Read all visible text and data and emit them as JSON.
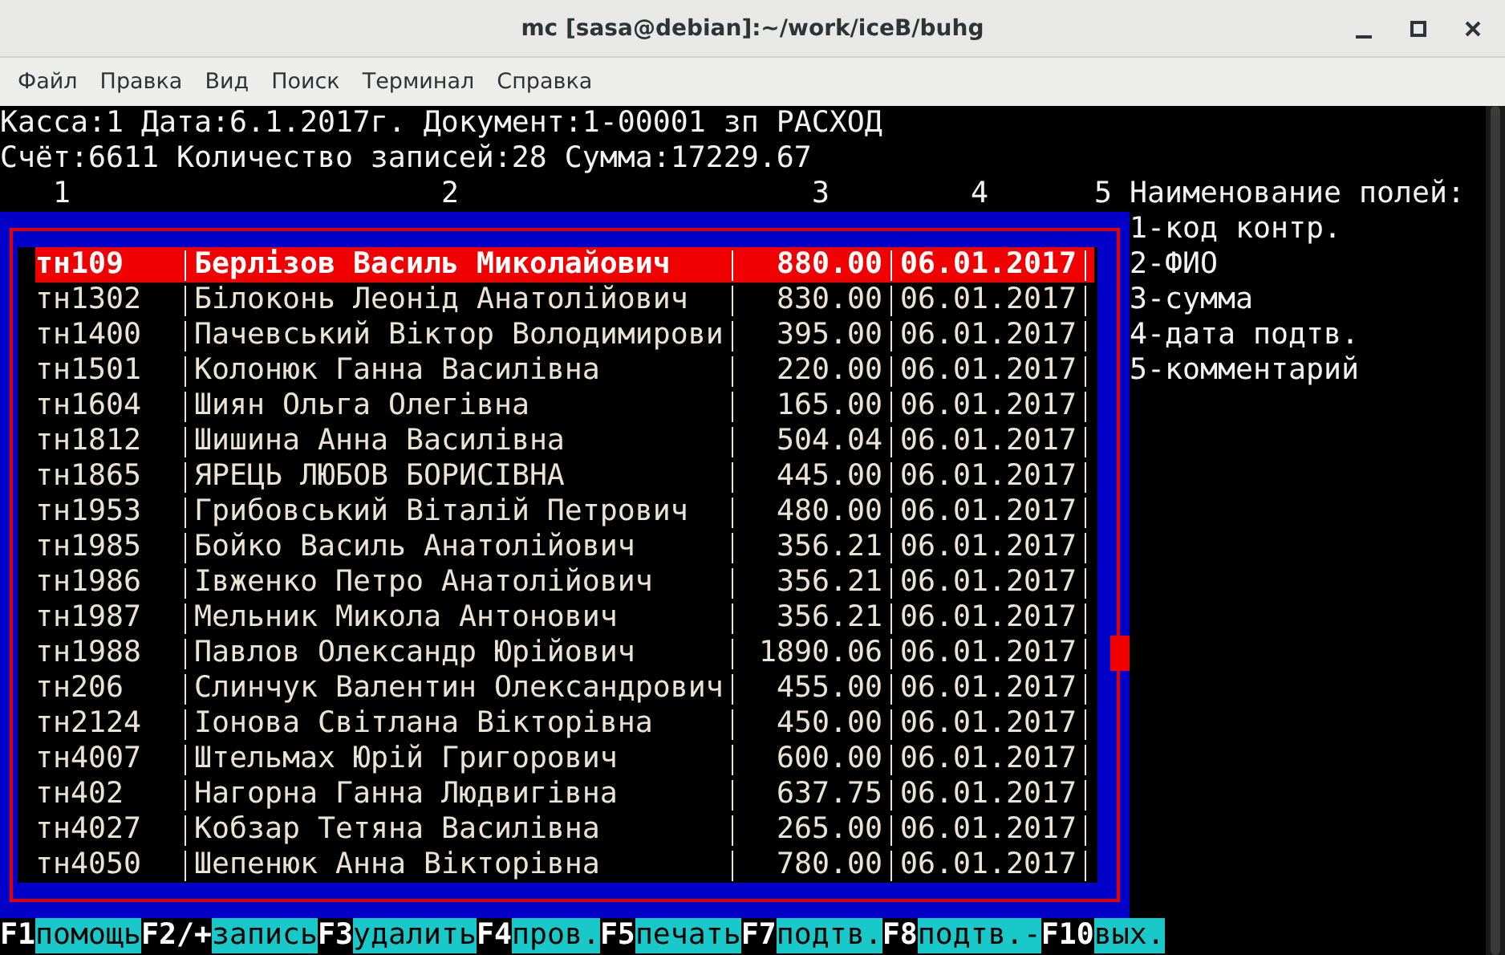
{
  "window": {
    "title": "mc [sasa@debian]:~/work/iceB/buhg"
  },
  "menu": [
    "Файл",
    "Правка",
    "Вид",
    "Поиск",
    "Терминал",
    "Справка"
  ],
  "header_lines": [
    "Касса:1 Дата:6.1.2017г. Документ:1-00001 зп РАСХОД",
    "Счёт:6611 Количество записей:28 Сумма:17229.67"
  ],
  "table": {
    "columns": [
      "1",
      "2",
      "3",
      "4",
      "5"
    ],
    "rows": [
      {
        "code": "тн109",
        "name": "Берлізов Василь Миколайович",
        "amount": "880.00",
        "date": "06.01.2017",
        "selected": true
      },
      {
        "code": "тн1302",
        "name": "Білоконь Леонід Анатолійович",
        "amount": "830.00",
        "date": "06.01.2017",
        "selected": false
      },
      {
        "code": "тн1400",
        "name": "Пачевський Віктор Володимирови",
        "amount": "395.00",
        "date": "06.01.2017",
        "selected": false
      },
      {
        "code": "тн1501",
        "name": "Колонюк Ганна Василівна",
        "amount": "220.00",
        "date": "06.01.2017",
        "selected": false
      },
      {
        "code": "тн1604",
        "name": "Шиян Ольга Олегівна",
        "amount": "165.00",
        "date": "06.01.2017",
        "selected": false
      },
      {
        "code": "тн1812",
        "name": "Шишина Анна Василівна",
        "amount": "504.04",
        "date": "06.01.2017",
        "selected": false
      },
      {
        "code": "тн1865",
        "name": "ЯРЕЦЬ ЛЮБОВ БОРИСІВНА",
        "amount": "445.00",
        "date": "06.01.2017",
        "selected": false
      },
      {
        "code": "тн1953",
        "name": "Грибовський Віталій Петрович",
        "amount": "480.00",
        "date": "06.01.2017",
        "selected": false
      },
      {
        "code": "тн1985",
        "name": "Бойко Василь Анатолійович",
        "amount": "356.21",
        "date": "06.01.2017",
        "selected": false
      },
      {
        "code": "тн1986",
        "name": "Івженко Петро Анатолійович",
        "amount": "356.21",
        "date": "06.01.2017",
        "selected": false
      },
      {
        "code": "тн1987",
        "name": "Мельник Микола Антонович",
        "amount": "356.21",
        "date": "06.01.2017",
        "selected": false
      },
      {
        "code": "тн1988",
        "name": "Павлов Олександр Юрійович",
        "amount": "1890.06",
        "date": "06.01.2017",
        "selected": false
      },
      {
        "code": "тн206",
        "name": "Слинчук Валентин Олександрович",
        "amount": "455.00",
        "date": "06.01.2017",
        "selected": false
      },
      {
        "code": "тн2124",
        "name": "Іонова Світлана Вікторівна",
        "amount": "450.00",
        "date": "06.01.2017",
        "selected": false
      },
      {
        "code": "тн4007",
        "name": "Штельмах Юрій Григорович",
        "amount": "600.00",
        "date": "06.01.2017",
        "selected": false
      },
      {
        "code": "тн402",
        "name": "Нагорна Ганна Людвигівна",
        "amount": "637.75",
        "date": "06.01.2017",
        "selected": false
      },
      {
        "code": "тн4027",
        "name": "Кобзар Тетяна Василівна",
        "amount": "265.00",
        "date": "06.01.2017",
        "selected": false
      },
      {
        "code": "тн4050",
        "name": "Шепенюк Анна Вікторівна",
        "amount": "780.00",
        "date": "06.01.2017",
        "selected": false
      }
    ]
  },
  "legend": {
    "title": "Наименование полей:",
    "items": [
      "1-код контр.",
      "2-ФИО",
      "3-сумма",
      "4-дата подтв.",
      "5-комментарий"
    ]
  },
  "function_keys": [
    {
      "key": "F1",
      "label": "помощь"
    },
    {
      "key": "F2/+",
      "label": "запись"
    },
    {
      "key": "F3",
      "label": "удалить"
    },
    {
      "key": "F4",
      "label": "пров."
    },
    {
      "key": "F5",
      "label": "печать"
    },
    {
      "key": "F7",
      "label": "подтв."
    },
    {
      "key": "F8",
      "label": "подтв.-"
    },
    {
      "key": "F10",
      "label": "вых."
    }
  ]
}
